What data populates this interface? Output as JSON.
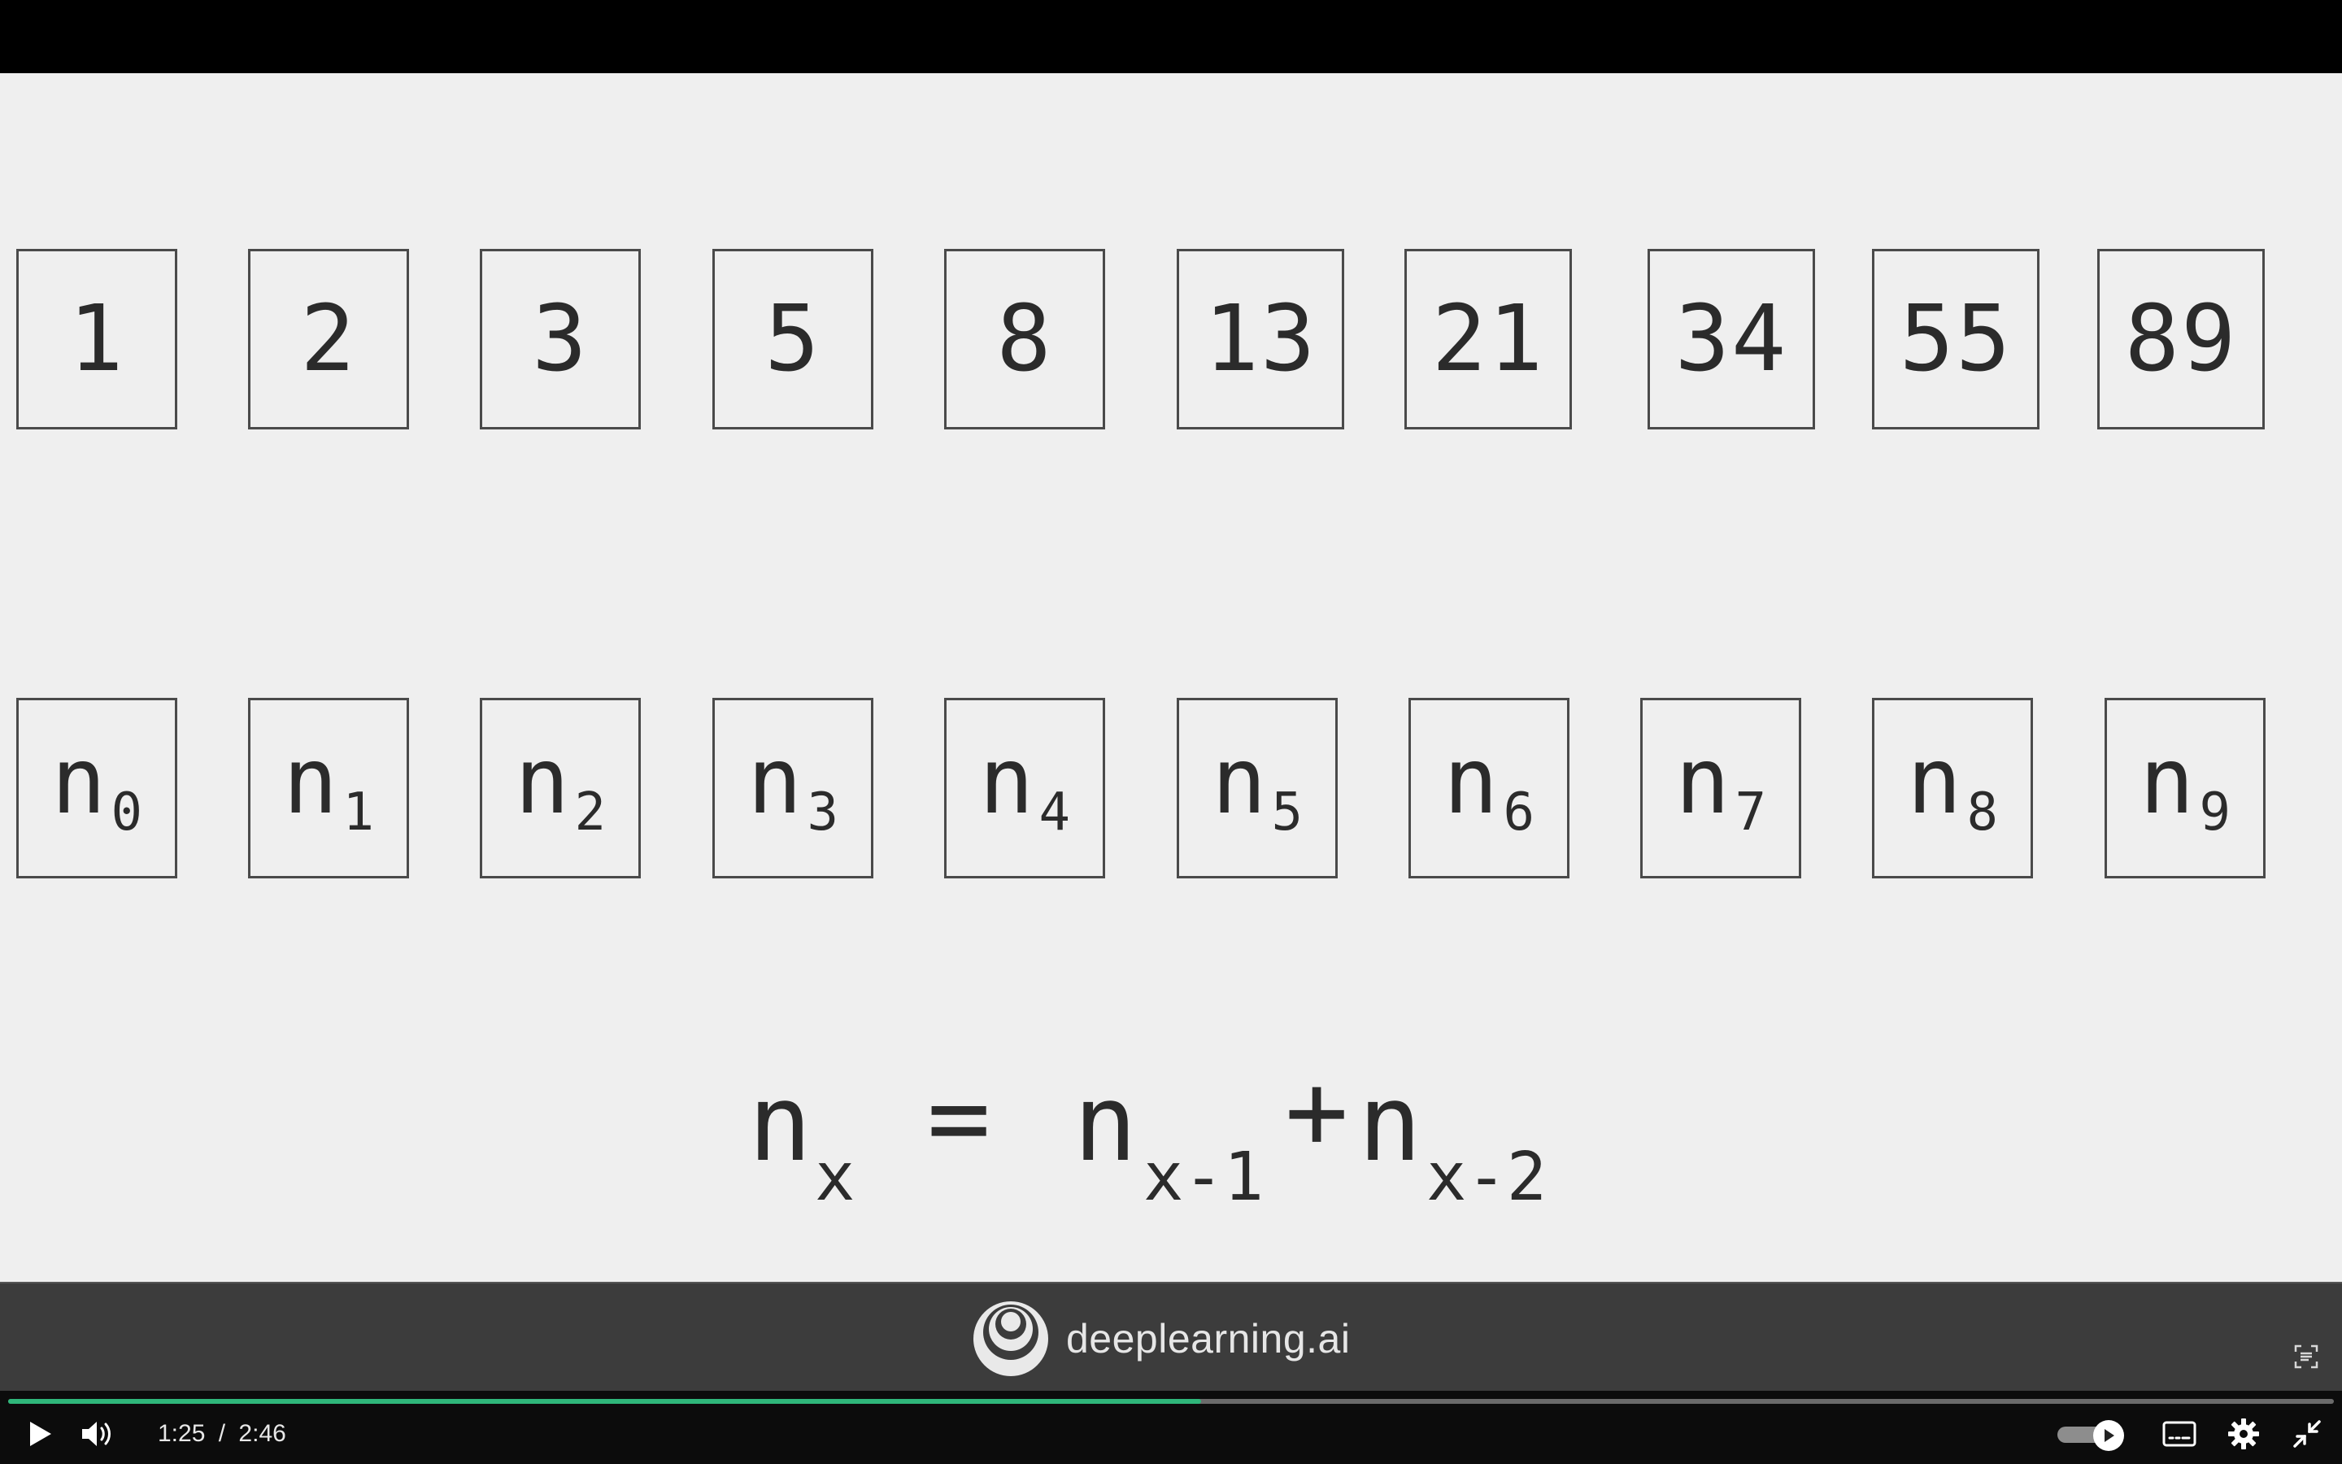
{
  "slide": {
    "values": [
      "1",
      "2",
      "3",
      "5",
      "8",
      "13",
      "21",
      "34",
      "55",
      "89"
    ],
    "variables": [
      {
        "base": "n",
        "sub": "0"
      },
      {
        "base": "n",
        "sub": "1"
      },
      {
        "base": "n",
        "sub": "2"
      },
      {
        "base": "n",
        "sub": "3"
      },
      {
        "base": "n",
        "sub": "4"
      },
      {
        "base": "n",
        "sub": "5"
      },
      {
        "base": "n",
        "sub": "6"
      },
      {
        "base": "n",
        "sub": "7"
      },
      {
        "base": "n",
        "sub": "8"
      },
      {
        "base": "n",
        "sub": "9"
      }
    ],
    "formula": {
      "lhs": "n",
      "lhs_sub": "x",
      "equals": "=",
      "t1": "n",
      "t1_sub": "x-1",
      "plus": "+",
      "t2": "n",
      "t2_sub": "x-2"
    }
  },
  "branding": {
    "text": "deeplearning.ai"
  },
  "player": {
    "current_time": "1:25",
    "separator": "/",
    "duration": "2:46",
    "progress": 0.513,
    "colors": {
      "progress": "#2fb67a",
      "slide_bg": "#efefef",
      "bar": "#3c3c3c"
    },
    "icons": [
      "play-icon",
      "volume-icon",
      "autoplay-toggle",
      "captions-icon",
      "settings-icon",
      "exit-fullscreen-icon",
      "capture-icon"
    ]
  }
}
